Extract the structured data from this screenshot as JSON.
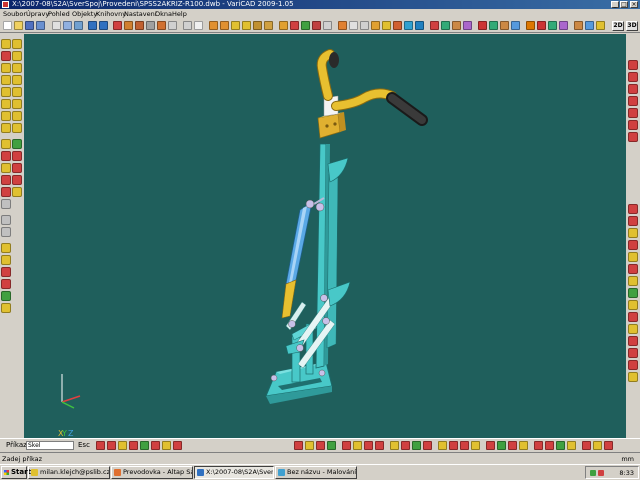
{
  "window": {
    "title": "X:\\2007-08\\S2A\\SverSpoj\\Provedeni\\SPSS2AKRIZ-R100.dwb - VariCAD 2009-1.05",
    "minimize": "_",
    "maximize": "□",
    "close": "×"
  },
  "menu": {
    "items": [
      "Soubor",
      "Úpravy",
      "Pohled",
      "Objekty",
      "Knihovny",
      "Nastavení",
      "Okna",
      "Help"
    ]
  },
  "view_buttons": {
    "view_2d": "2D",
    "view_3d": "3D"
  },
  "viewport": {
    "background": "#1f5f5c",
    "axis_x": "X",
    "axis_y": "Y",
    "axis_z": "Z"
  },
  "command": {
    "label": "Příkaz",
    "input_value": "Skel",
    "esc_label": "Esc"
  },
  "status": {
    "prompt": "Zadej příkaz",
    "units": "mm"
  },
  "taskbar": {
    "start": "Start",
    "tasks": [
      "milan.klejch@pslib.cz - 3...",
      "Prevodovka - Altap Sala...",
      "X:\\2007-08\\S2A\\Sver...",
      "Bez názvu - Malování"
    ],
    "clock": "8:33"
  },
  "colors": {
    "mechanism": "#48c8c8",
    "cylinder": "#5aa9e6",
    "handlebar": "#e8c030",
    "grip": "#333333",
    "clamp": "#e0b030",
    "titlebar": "#0a246a"
  }
}
